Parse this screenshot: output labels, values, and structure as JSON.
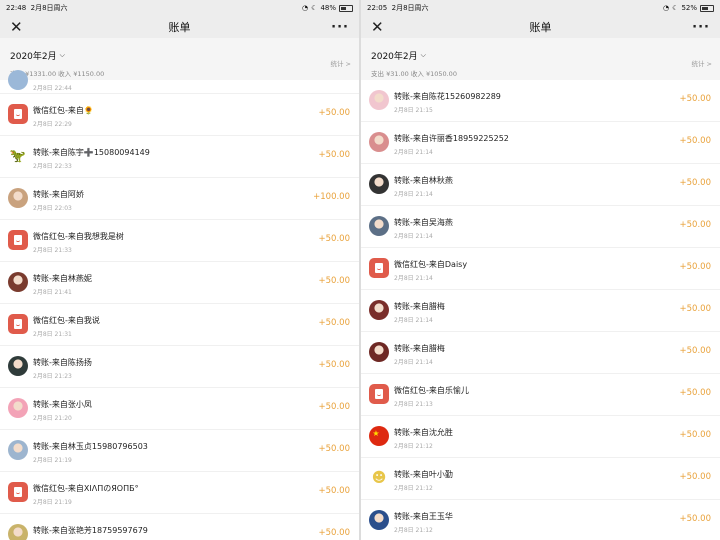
{
  "left": {
    "status": {
      "time": "22:48",
      "date": "2月8日周六",
      "battery": "48%",
      "battery_level": 0.48
    },
    "title": "账单",
    "month": "2020年2月",
    "totals": "支出 ¥1331.00 收入 ¥1150.00",
    "stats": "统计 >",
    "partial_date": "2月8日 22:44",
    "rows": [
      {
        "name": "微信红包-来自🌻",
        "date": "2月8日 22:29",
        "amount": "+50.00",
        "avatar": "red-envelope",
        "color": "#e05b4b"
      },
      {
        "name": "转账-来自陈宇➕15080094149",
        "date": "2月8日 22:33",
        "amount": "+50.00",
        "avatar": "dino",
        "color": "#4caf50"
      },
      {
        "name": "转账-来自阿娇",
        "date": "2月8日 22:03",
        "amount": "+100.00",
        "avatar": "photo",
        "color": "#c9a27e"
      },
      {
        "name": "微信红包-来自我想我是树",
        "date": "2月8日 21:33",
        "amount": "+50.00",
        "avatar": "red-envelope",
        "color": "#e05b4b"
      },
      {
        "name": "转账-来自林燕妮",
        "date": "2月8日 21:41",
        "amount": "+50.00",
        "avatar": "photo",
        "color": "#7a3b2e"
      },
      {
        "name": "微信红包-来自我说",
        "date": "2月8日 21:31",
        "amount": "+50.00",
        "avatar": "red-envelope",
        "color": "#e05b4b"
      },
      {
        "name": "转账-来自陈扬扬",
        "date": "2月8日 21:23",
        "amount": "+50.00",
        "avatar": "photo",
        "color": "#2f3b3a"
      },
      {
        "name": "转账-来自张小凤",
        "date": "2月8日 21:20",
        "amount": "+50.00",
        "avatar": "photo",
        "color": "#f3a3b7"
      },
      {
        "name": "转账-来自林玉贞15980796503",
        "date": "2月8日 21:19",
        "amount": "+50.00",
        "avatar": "photo",
        "color": "#9db5cf"
      },
      {
        "name": "微信红包-来自XIΛΠのЯΟΠБ°",
        "date": "2月8日 21:19",
        "amount": "+50.00",
        "avatar": "red-envelope",
        "color": "#e05b4b"
      },
      {
        "name": "转账-来自张艳芳18759597679",
        "date": "",
        "amount": "+50.00",
        "avatar": "photo",
        "color": "#c9b36a"
      }
    ]
  },
  "right": {
    "status": {
      "time": "22:05",
      "date": "2月8日周六",
      "battery": "52%",
      "battery_level": 0.52
    },
    "title": "账单",
    "month": "2020年2月",
    "totals": "支出 ¥31.00 收入 ¥1050.00",
    "stats": "统计 >",
    "rows": [
      {
        "name": "转账-来自陈花15260982289",
        "date": "2月8日 21:15",
        "amount": "+50.00",
        "avatar": "photo",
        "color": "#f1c6cf"
      },
      {
        "name": "转账-来自许丽香18959225252",
        "date": "2月8日 21:14",
        "amount": "+50.00",
        "avatar": "photo",
        "color": "#d98e8e"
      },
      {
        "name": "转账-来自林秋燕",
        "date": "2月8日 21:14",
        "amount": "+50.00",
        "avatar": "photo",
        "color": "#333333"
      },
      {
        "name": "转账-来自吴海燕",
        "date": "2月8日 21:14",
        "amount": "+50.00",
        "avatar": "photo",
        "color": "#5c6f86"
      },
      {
        "name": "微信红包-来自Daisy",
        "date": "2月8日 21:14",
        "amount": "+50.00",
        "avatar": "red-envelope",
        "color": "#e05b4b"
      },
      {
        "name": "转账-来自腊梅",
        "date": "2月8日 21:14",
        "amount": "+50.00",
        "avatar": "photo",
        "color": "#7a2e2a"
      },
      {
        "name": "转账-来自腊梅",
        "date": "2月8日 21:14",
        "amount": "+50.00",
        "avatar": "photo",
        "color": "#6e2824"
      },
      {
        "name": "微信红包-来自乐愉儿",
        "date": "2月8日 21:13",
        "amount": "+50.00",
        "avatar": "red-envelope",
        "color": "#e05b4b"
      },
      {
        "name": "转账-来自沈允胜",
        "date": "2月8日 21:12",
        "amount": "+50.00",
        "avatar": "flag",
        "color": "#de2910"
      },
      {
        "name": "转账-来自叶小勤",
        "date": "2月8日 21:12",
        "amount": "+50.00",
        "avatar": "cartoon",
        "color": "#e8c64a"
      },
      {
        "name": "转账-来自王玉华",
        "date": "2月8日 21:12",
        "amount": "+50.00",
        "avatar": "photo",
        "color": "#2b4f8c"
      }
    ]
  }
}
